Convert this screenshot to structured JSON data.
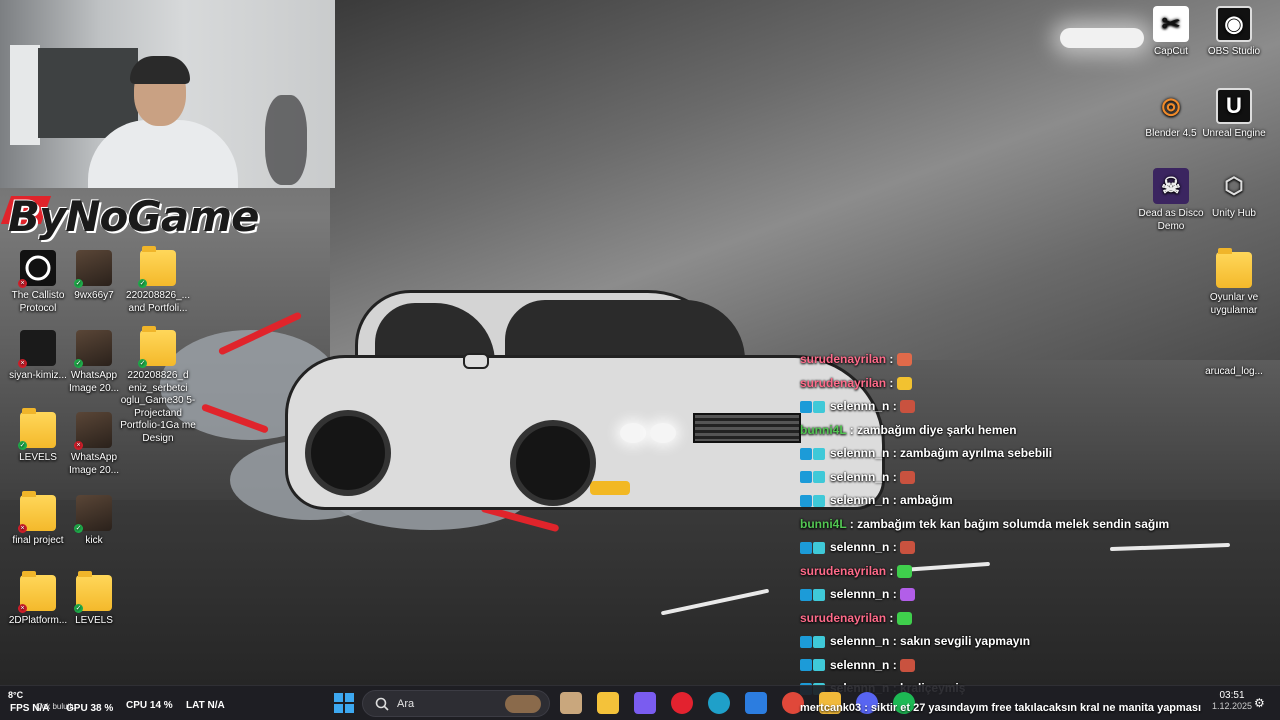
{
  "brand": {
    "logo_text": "ByNoGame"
  },
  "desktop_icons_left": [
    {
      "label": "The Callisto Protocol",
      "kind": "dark-round",
      "badge": "red"
    },
    {
      "label": "9wx66y7",
      "kind": "photo",
      "badge": "green"
    },
    {
      "label": "220208826_... and Portfoli...",
      "kind": "folder",
      "badge": "green"
    },
    {
      "label": "siyan-kimiz...",
      "kind": "dark",
      "badge": "red"
    },
    {
      "label": "WhatsApp Image 20...",
      "kind": "photo",
      "badge": "green"
    },
    {
      "label": "220208826_d eniz_serbetci oglu_Game30 5-Projectand Portfolio-1Ga me Design",
      "kind": "folder",
      "badge": "green"
    },
    {
      "label": "LEVELS",
      "kind": "folder",
      "badge": "green"
    },
    {
      "label": "WhatsApp Image 20...",
      "kind": "photo",
      "badge": "red"
    },
    {
      "label": "final project",
      "kind": "folder",
      "badge": "red"
    },
    {
      "label": "kick",
      "kind": "photo",
      "badge": "green"
    },
    {
      "label": "2DPlatform...",
      "kind": "folder",
      "badge": "red"
    },
    {
      "label": "LEVELS",
      "kind": "folder",
      "badge": "green"
    }
  ],
  "desktop_icons_right": [
    {
      "label": "CapCut",
      "glyph": "✂",
      "kind": "white-sq"
    },
    {
      "label": "OBS Studio",
      "glyph": "◉",
      "kind": "dark-round"
    },
    {
      "label": "Blender 4.5",
      "glyph": "◎",
      "kind": "blender"
    },
    {
      "label": "Unreal Engine",
      "glyph": "U",
      "kind": "dark-round"
    },
    {
      "label": "Dead as Disco Demo",
      "glyph": "☠",
      "kind": "purple"
    },
    {
      "label": "Unity Hub",
      "glyph": "⬡",
      "kind": "unity"
    },
    {
      "label": "Oyunlar ve uygulamar",
      "glyph": "",
      "kind": "folder"
    },
    {
      "label": "arucad_log...",
      "glyph": "",
      "kind": "none"
    }
  ],
  "chat": [
    {
      "user": "surudenayrilan",
      "user_color": "#ff6b8a",
      "badges": false,
      "message": "",
      "emote": "#e06a4a"
    },
    {
      "user": "surudenayrilan",
      "user_color": "#ff6b8a",
      "badges": false,
      "message": "",
      "emote": "#f2c230"
    },
    {
      "user": "selennn_n",
      "user_color": "#ffffff",
      "badges": true,
      "message": "",
      "emote": "#c9523f"
    },
    {
      "user": "bunni4L",
      "user_color": "#53c653",
      "badges": false,
      "message": "zambağım diye şarkı hemen",
      "emote": ""
    },
    {
      "user": "selennn_n",
      "user_color": "#ffffff",
      "badges": true,
      "message": "zambağım ayrılma sebebili",
      "emote": ""
    },
    {
      "user": "selennn_n",
      "user_color": "#ffffff",
      "badges": true,
      "message": "",
      "emote": "#c9523f"
    },
    {
      "user": "selennn_n",
      "user_color": "#ffffff",
      "badges": true,
      "message": "ambağım",
      "emote": ""
    },
    {
      "user": "bunni4L",
      "user_color": "#53c653",
      "badges": false,
      "message": "zambağım tek kan bağım solumda melek sendin sağım",
      "emote": ""
    },
    {
      "user": "selennn_n",
      "user_color": "#ffffff",
      "badges": true,
      "message": "",
      "emote": "#c9523f"
    },
    {
      "user": "surudenayrilan",
      "user_color": "#ff6b8a",
      "badges": false,
      "message": "",
      "emote": "#3fcf4c"
    },
    {
      "user": "selennn_n",
      "user_color": "#ffffff",
      "badges": true,
      "message": "",
      "emote": "#b25ee8"
    },
    {
      "user": "surudenayrilan",
      "user_color": "#ff6b8a",
      "badges": false,
      "message": "",
      "emote": "#3fcf4c"
    },
    {
      "user": "selennn_n",
      "user_color": "#ffffff",
      "badges": true,
      "message": "sakın sevgili yapmayın",
      "emote": ""
    },
    {
      "user": "selennn_n",
      "user_color": "#ffffff",
      "badges": true,
      "message": "",
      "emote": "#c9523f"
    },
    {
      "user": "selennn_n",
      "user_color": "#ffffff",
      "badges": true,
      "message": "kraliçeymiş",
      "emote": ""
    }
  ],
  "ticker": "mertcank03 : siktir et 27 yasındayım free takılacaksın kral ne manita yapması",
  "taskbar": {
    "weather_temp": "8°C",
    "weather_desc": "Çok bulutlu",
    "fps_label": "FPS",
    "fps_value": "N/A",
    "gpu_label": "GPU",
    "gpu_value": "38 %",
    "cpu_label": "CPU",
    "cpu_value": "14 %",
    "lat_label": "LAT",
    "lat_value": "N/A",
    "search_label": "Ara",
    "time": "03:51",
    "date": "1.12.2025",
    "pinned_apps": [
      {
        "name": "widgets-icon",
        "color": "#c9a77d"
      },
      {
        "name": "file-explorer-icon",
        "color": "#f4c23a"
      },
      {
        "name": "copilot-icon",
        "color": "#7a5cf0"
      },
      {
        "name": "opera-icon",
        "color": "#e3222f"
      },
      {
        "name": "edge-icon",
        "color": "#1fa0c9"
      },
      {
        "name": "store-icon",
        "color": "#2c7de0"
      },
      {
        "name": "chrome-icon",
        "color": "#e0483a"
      },
      {
        "name": "folder-icon",
        "color": "#f1b93a"
      },
      {
        "name": "discord-icon",
        "color": "#5865f2"
      },
      {
        "name": "spotify-icon",
        "color": "#1db954"
      }
    ]
  }
}
